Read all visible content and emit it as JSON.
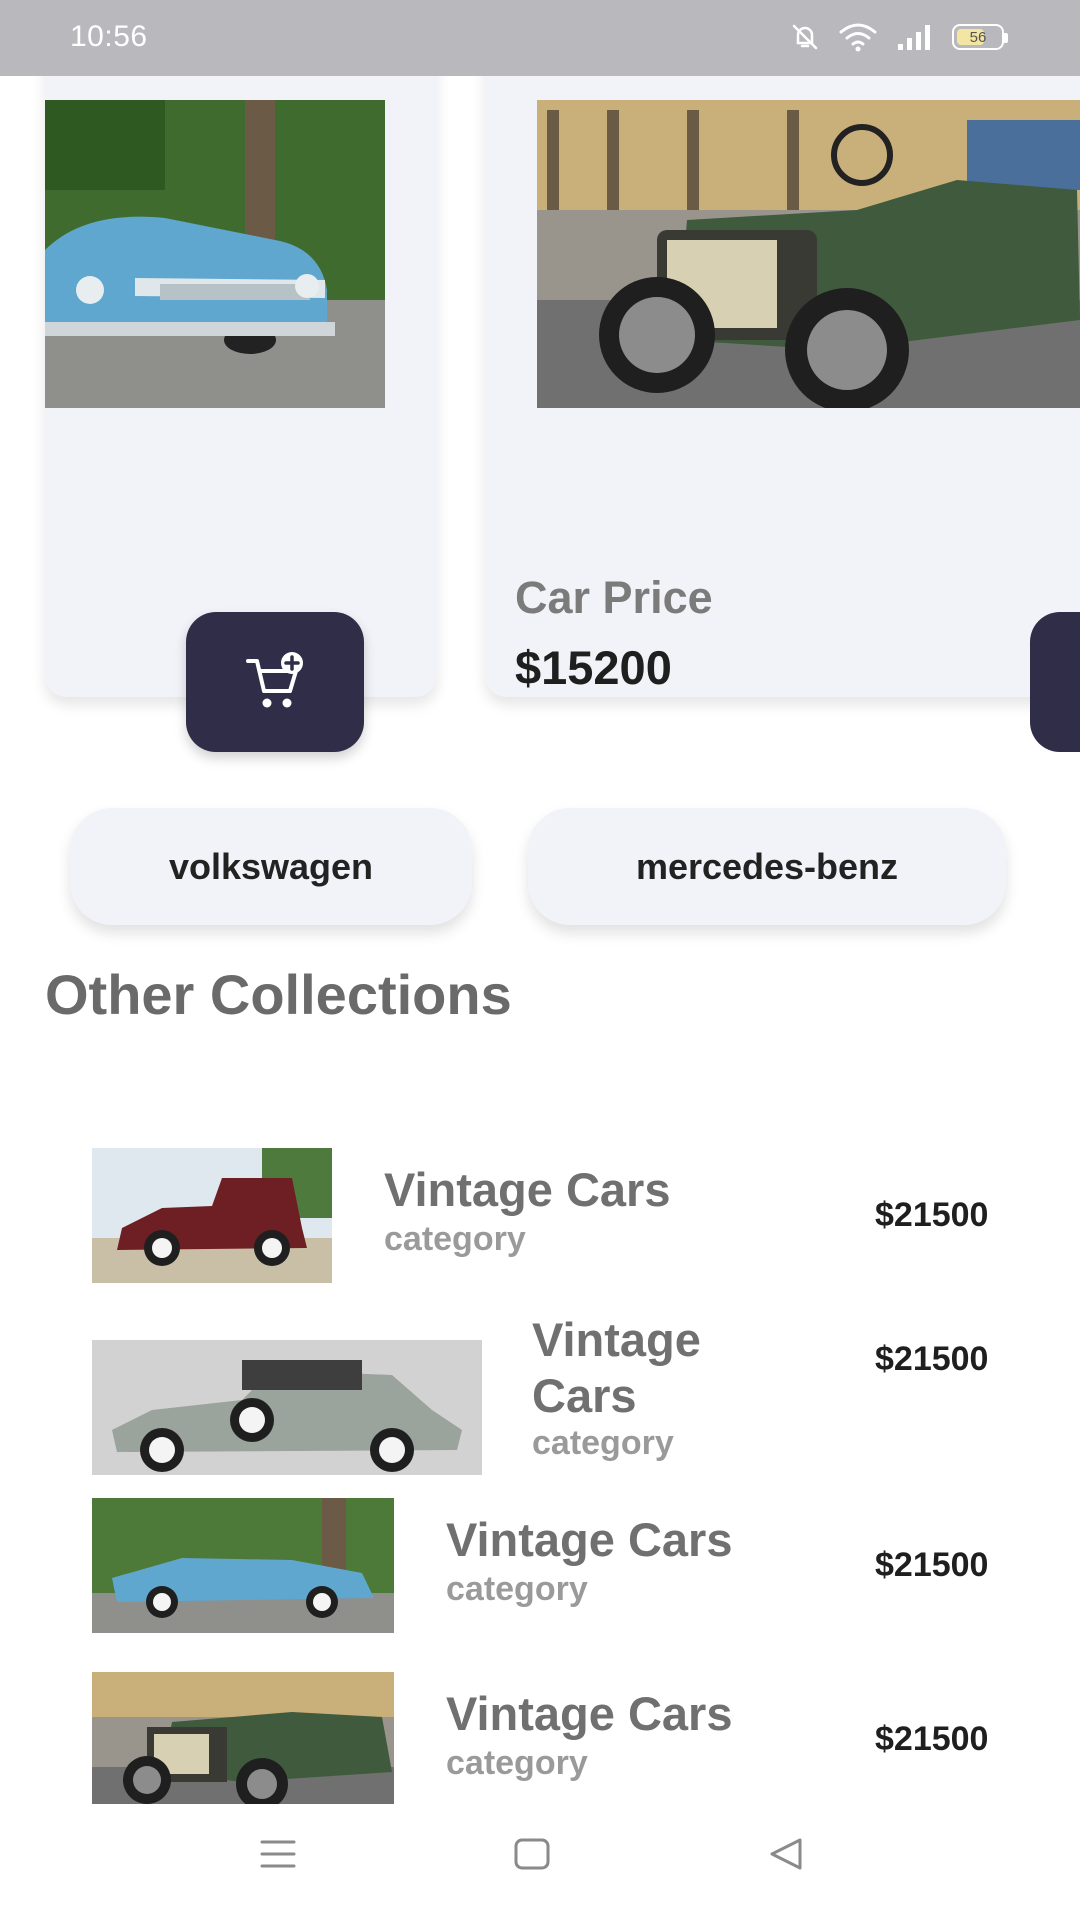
{
  "status_bar": {
    "time": "10:56",
    "battery_percent": "56",
    "icons": [
      "mute-bell-icon",
      "wifi-icon",
      "signal-icon",
      "battery-icon"
    ]
  },
  "featured": {
    "price_label": "Car Price",
    "price_value": "$15200",
    "add_to_cart_icon": "cart-add-icon"
  },
  "brands": {
    "items": [
      "volkswagen",
      "mercedes-benz"
    ]
  },
  "other_collections": {
    "title": "Other Collections",
    "items": [
      {
        "title": "Vintage Cars",
        "category": "category",
        "price": "$21500"
      },
      {
        "title": "Vintage Cars",
        "category": "category",
        "price": "$21500"
      },
      {
        "title": "Vintage Cars",
        "category": "category",
        "price": "$21500"
      },
      {
        "title": "Vintage Cars",
        "category": "category",
        "price": "$21500"
      }
    ]
  },
  "navigation": {
    "icons": [
      "menu-icon",
      "home-icon",
      "back-icon"
    ]
  },
  "colors": {
    "accent": "#2f2d48",
    "card_background": "#f2f3f9",
    "status_bar": "#b9b9bd"
  }
}
